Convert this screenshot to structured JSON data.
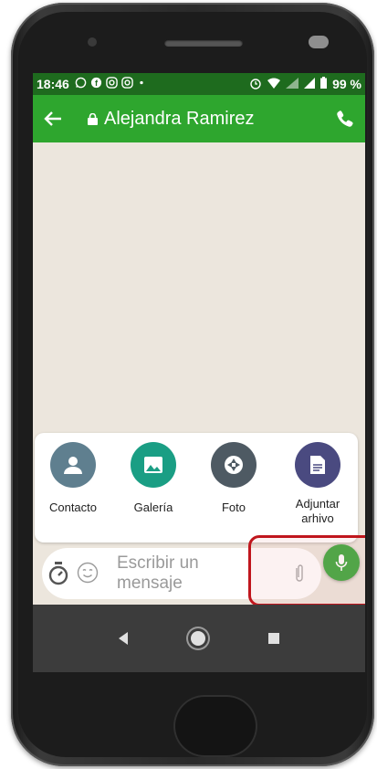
{
  "status_bar": {
    "time": "18:46",
    "battery": "99 %",
    "left_icons": [
      "whatsapp-icon",
      "facebook-icon",
      "instagram-icon",
      "instagram-icon",
      "dot"
    ],
    "right_icons": [
      "alarm-icon",
      "wifi-icon",
      "signal-4g-icon",
      "signal-icon",
      "battery-icon"
    ]
  },
  "app_bar": {
    "contact_name": "Alejandra Ramirez",
    "color": "#2ea62e"
  },
  "attach_sheet": {
    "items": [
      {
        "label": "Contacto",
        "icon": "person-icon",
        "color": "#5f7f8f"
      },
      {
        "label": "Galería",
        "icon": "image-icon",
        "color": "#1a9e84"
      },
      {
        "label": "Foto",
        "icon": "camera-shutter-icon",
        "color": "#4e5a63"
      },
      {
        "label": "Adjuntar\narhivo",
        "icon": "document-icon",
        "color": "#4a4a80"
      }
    ]
  },
  "input": {
    "placeholder": "Escribir un mensaje"
  },
  "highlight_color": "#c0161d"
}
